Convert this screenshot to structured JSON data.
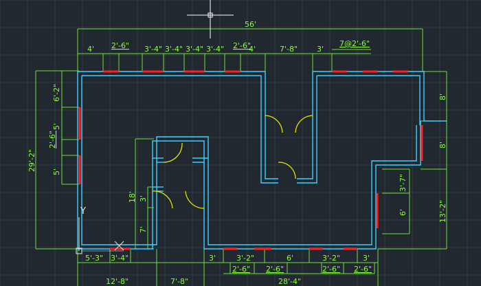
{
  "viewport": {
    "background": "#212830",
    "grid_color": "#2f3842"
  },
  "colors": {
    "dimension": "#6ee03a",
    "wall": "#40d0ff",
    "window": "#ff2020",
    "door": "#e6e600",
    "cursor": "#ffffff"
  },
  "ucs": {
    "y_axis_label": "Y"
  },
  "dimensions": {
    "overall_width": "56'",
    "top_segments": [
      "4'",
      "2'-6\"",
      "3'-4\"",
      "3'-4\"",
      "3'-4\"",
      "3'-4\"",
      "2'-6\"",
      "4'",
      "7'-8\"",
      "3'",
      "7@2'-6\""
    ],
    "left_overall": "29'-2\"",
    "left_segments": [
      "6'-2\"",
      "2'-6\"",
      "5'",
      "5'"
    ],
    "interior_18": "18'",
    "interior_3": "3'",
    "interior_7": "7'",
    "right_segments": [
      "8'",
      "8'",
      "13'-2\""
    ],
    "right_inner": [
      "3'-7\"",
      "6'"
    ],
    "bottom_row1": [
      "5'-3\"",
      "3'-4\"",
      "3'",
      "3'-2\"",
      "6'",
      "3'-2\"",
      "3'"
    ],
    "bottom_row2": [
      "2'-6\"",
      "2'-6\"",
      "2'-6\"",
      "2'-6\""
    ],
    "bottom_row3": [
      "12'-8\"",
      "7'-8\"",
      "28'-4\""
    ]
  }
}
